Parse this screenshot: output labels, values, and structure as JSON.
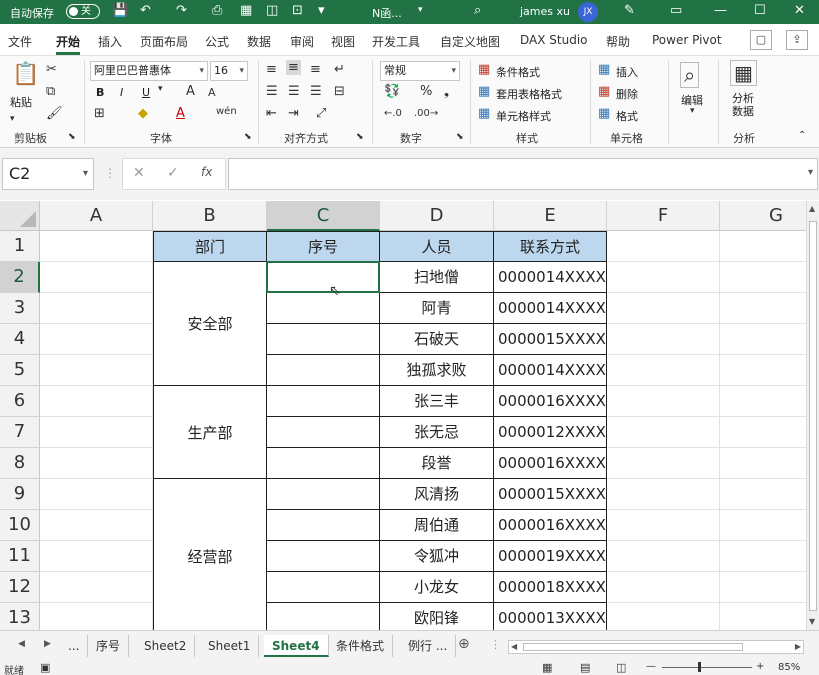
{
  "titlebar": {
    "autosave_label": "自动保存",
    "toggle_state": "关",
    "doc_name": "N函...",
    "user_name": "james xu",
    "avatar_initials": "JX",
    "accent": "#217346"
  },
  "ribbon_tabs": [
    "文件",
    "开始",
    "插入",
    "页面布局",
    "公式",
    "数据",
    "审阅",
    "视图",
    "开发工具",
    "自定义地图",
    "DAX Studio",
    "帮助",
    "Power Pivot"
  ],
  "active_tab": "开始",
  "ribbon": {
    "clipboard": {
      "paste": "粘贴",
      "label": "剪贴板"
    },
    "font": {
      "name": "阿里巴巴普惠体",
      "size": "16",
      "label": "字体",
      "bold": "B",
      "italic": "I",
      "underline": "U"
    },
    "alignment": {
      "label": "对齐方式"
    },
    "number": {
      "format": "常规",
      "label": "数字"
    },
    "styles": {
      "conditional": "条件格式",
      "table": "套用表格格式",
      "cell": "单元格样式",
      "label": "样式"
    },
    "cells": {
      "insert": "插入",
      "delete": "删除",
      "format": "格式",
      "label": "单元格"
    },
    "editing": {
      "label": "编辑"
    },
    "analysis": {
      "btn": "分析数据",
      "label": "分析"
    }
  },
  "formula_bar": {
    "name_box": "C2",
    "value": ""
  },
  "columns": [
    "A",
    "B",
    "C",
    "D",
    "E",
    "F",
    "G"
  ],
  "selected_column": "C",
  "rows": [
    "1",
    "2",
    "3",
    "4",
    "5",
    "6",
    "7",
    "8",
    "9",
    "10",
    "11",
    "12",
    "13"
  ],
  "selected_row": "2",
  "table": {
    "headers": [
      "部门",
      "序号",
      "人员",
      "联系方式"
    ],
    "header_fill": "#bdd7ee",
    "departments": [
      {
        "name": "安全部",
        "span": 4
      },
      {
        "name": "生产部",
        "span": 3
      },
      {
        "name": "经营部",
        "span": 5
      }
    ],
    "records": [
      {
        "person": "扫地僧",
        "contact": "0000014XXXX"
      },
      {
        "person": "阿青",
        "contact": "0000014XXXX"
      },
      {
        "person": "石破天",
        "contact": "0000015XXXX"
      },
      {
        "person": "独孤求败",
        "contact": "0000014XXXX"
      },
      {
        "person": "张三丰",
        "contact": "0000016XXXX"
      },
      {
        "person": "张无忌",
        "contact": "0000012XXXX"
      },
      {
        "person": "段誉",
        "contact": "0000016XXXX"
      },
      {
        "person": "风清扬",
        "contact": "0000015XXXX"
      },
      {
        "person": "周伯通",
        "contact": "0000016XXXX"
      },
      {
        "person": "令狐冲",
        "contact": "0000019XXXX"
      },
      {
        "person": "小龙女",
        "contact": "0000018XXXX"
      },
      {
        "person": "欧阳锋",
        "contact": "0000013XXXX"
      }
    ]
  },
  "sheet_tabs": [
    "...",
    "序号",
    "Sheet2",
    "Sheet1",
    "Sheet4",
    "条件格式",
    "例行 ..."
  ],
  "active_sheet": "Sheet4",
  "statusbar": {
    "ready": "就绪",
    "zoom": "85%"
  }
}
